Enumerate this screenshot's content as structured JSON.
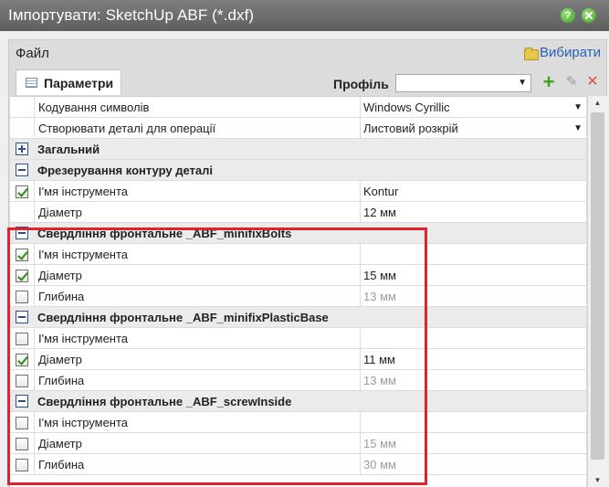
{
  "window": {
    "title": "Імпортувати: SketchUp ABF (*.dxf)"
  },
  "file": {
    "title": "Файл",
    "choose_label": "Вибирати"
  },
  "tab": {
    "label": "Параметри"
  },
  "profile": {
    "label": "Профіль",
    "value": ""
  },
  "rows": [
    {
      "type": "prop",
      "name": "Кодування символів",
      "value": "Windows Cyrillic",
      "dropdown": true,
      "checkbox": null,
      "dim": false
    },
    {
      "type": "prop",
      "name": "Створювати деталі для операції",
      "value": "Листовий розкрій",
      "dropdown": true,
      "checkbox": null,
      "dim": false
    },
    {
      "type": "group",
      "name": "Загальний",
      "expanded": false
    },
    {
      "type": "group",
      "name": "Фрезерування контуру деталі",
      "expanded": true
    },
    {
      "type": "prop",
      "name": "І'мя інструмента",
      "value": "Kontur",
      "checkbox": true,
      "dim": false
    },
    {
      "type": "prop",
      "name": "Діаметр",
      "value": "12 мм",
      "checkbox": null,
      "dim": false
    },
    {
      "type": "group",
      "name": "Свердління фронтальне _ABF_minifixBolts",
      "expanded": true
    },
    {
      "type": "prop",
      "name": "І'мя інструмента",
      "value": "",
      "checkbox": true,
      "dim": false
    },
    {
      "type": "prop",
      "name": "Діаметр",
      "value": "15 мм",
      "checkbox": true,
      "dim": false
    },
    {
      "type": "prop",
      "name": "Глибина",
      "value": "13 мм",
      "checkbox": false,
      "dim": true
    },
    {
      "type": "group",
      "name": "Свердління фронтальне _ABF_minifixPlasticBase",
      "expanded": true
    },
    {
      "type": "prop",
      "name": "І'мя інструмента",
      "value": "",
      "checkbox": false,
      "dim": false
    },
    {
      "type": "prop",
      "name": "Діаметр",
      "value": "11 мм",
      "checkbox": true,
      "dim": false
    },
    {
      "type": "prop",
      "name": "Глибина",
      "value": "13 мм",
      "checkbox": false,
      "dim": true
    },
    {
      "type": "group",
      "name": "Свердління фронтальне _ABF_screwInside",
      "expanded": true
    },
    {
      "type": "prop",
      "name": "І'мя інструмента",
      "value": "",
      "checkbox": false,
      "dim": false
    },
    {
      "type": "prop",
      "name": "Діаметр",
      "value": "15 мм",
      "checkbox": false,
      "dim": true
    },
    {
      "type": "prop",
      "name": "Глибина",
      "value": "30 мм",
      "checkbox": false,
      "dim": true
    }
  ],
  "colors": {
    "titlebar": "#6e6e6e",
    "accent_link": "#2a63b5",
    "highlight": "#e0242f",
    "check": "#2c8d12"
  }
}
